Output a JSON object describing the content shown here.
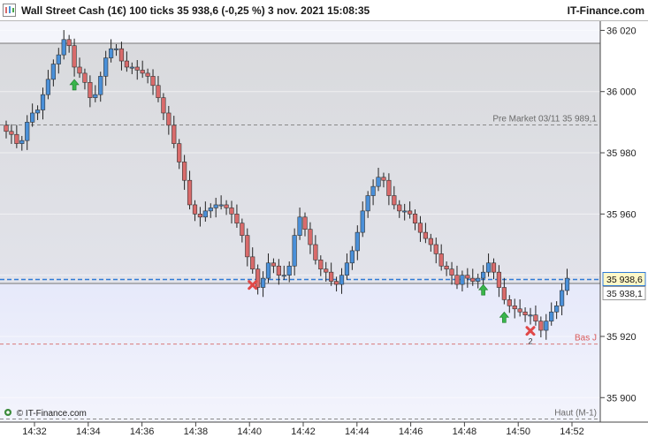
{
  "header": {
    "title": "Wall Street Cash (1€) 100 ticks 35 938,6 (-0,25 %) 3 nov. 2021 15:08:35",
    "brand": "IT-Finance.com"
  },
  "footer": {
    "copyright": "© IT-Finance.com"
  },
  "colors": {
    "up": "#4a90d9",
    "down": "#d96b6b",
    "shade_top": "#dcdde0",
    "shade_bottom": "#eceefa",
    "current_line": "#2f7ad6"
  },
  "chart_data": {
    "type": "candlestick",
    "ylim": [
      35892,
      36023
    ],
    "yticks": [
      {
        "value": 36020,
        "label": "36 020"
      },
      {
        "value": 36000,
        "label": "36 000"
      },
      {
        "value": 35980,
        "label": "35 980"
      },
      {
        "value": 35960,
        "label": "35 960"
      },
      {
        "value": 35940,
        "label": "35 940"
      },
      {
        "value": 35920,
        "label": "35 920"
      },
      {
        "value": 35900,
        "label": "35 900"
      }
    ],
    "xticks": [
      "14:32",
      "14:34",
      "14:36",
      "14:38",
      "14:40",
      "14:42",
      "14:44",
      "14:46",
      "14:48",
      "14:50",
      "14:52"
    ],
    "close": [
      35987,
      35986,
      35983,
      35984,
      35990,
      35993,
      35994,
      35999,
      36004,
      36009,
      36012,
      36017,
      36015,
      36008,
      36006,
      36003,
      35998,
      35999,
      36005,
      36011,
      36014,
      36014,
      36010,
      36008,
      36008,
      36007,
      36006,
      36005,
      36002,
      35998,
      35993,
      35989,
      35983,
      35977,
      35971,
      35963,
      35960,
      35959,
      35961,
      35962,
      35963,
      35963,
      35962,
      35960,
      35957,
      35953,
      35946,
      35942,
      35936,
      35939,
      35944,
      35943,
      35940,
      35940,
      35943,
      35953,
      35959,
      35955,
      35950,
      35945,
      35942,
      35941,
      35938,
      35937,
      35940,
      35944,
      35948,
      35954,
      35961,
      35966,
      35969,
      35972,
      35971,
      35966,
      35963,
      35961,
      35961,
      35960,
      35957,
      35954,
      35952,
      35950,
      35947,
      35943,
      35942,
      35940,
      35937,
      35940,
      35939,
      35938,
      35939,
      35941,
      35944,
      35941,
      35936,
      35932,
      35930,
      35929,
      35928,
      35927,
      35927,
      35925,
      35922,
      35925,
      35928,
      35930,
      35935,
      35939
    ],
    "series_labels": [
      {
        "text": "Pre Market 03/11 35 989,1",
        "value": 35989.1
      },
      {
        "text": "Bas J",
        "value": 35917.5
      },
      {
        "text": "Haut (M-1)",
        "value": 35893
      }
    ],
    "current_price": {
      "label": "35 938,6",
      "value": 35938.6
    },
    "previous_close": {
      "label": "35 938,1",
      "value": 35938.1
    },
    "buy_signals": [
      {
        "index": 13
      },
      {
        "index": 91
      },
      {
        "index": 95
      }
    ],
    "sell_signals": [
      {
        "index": 47
      },
      {
        "index": 100,
        "label": "2"
      }
    ]
  }
}
